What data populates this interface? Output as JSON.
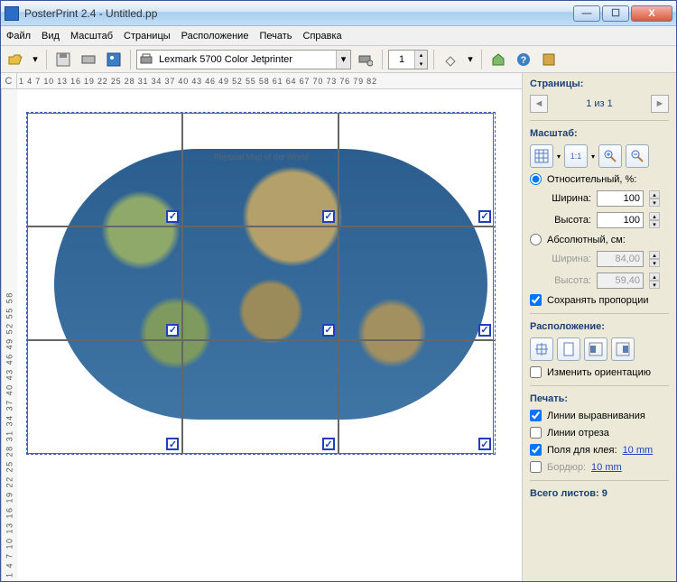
{
  "window": {
    "title": "PosterPrint 2.4 - Untitled.pp"
  },
  "menu": {
    "file": "Файл",
    "view": "Вид",
    "zoom": "Масштаб",
    "pages": "Страницы",
    "layout": "Расположение",
    "print": "Печать",
    "help": "Справка"
  },
  "toolbar": {
    "printer": "Lexmark 5700 Color Jetprinter",
    "page_spin": "1"
  },
  "ruler": {
    "h": "1  4  7  10 13 16 19 22 25 28 31 34 37 40 43 46 49 52 55 58 61 64 67 70 73 76 79 82",
    "v": "1 4 7 10 13 16 19 22 25 28 31 34 37 40 43 46 49 52 55 58",
    "corner": "C"
  },
  "canvas": {
    "map_title": "Physical Map of the World",
    "cols": 3,
    "rows": 3
  },
  "sidebar": {
    "pages": {
      "title": "Страницы:",
      "nav_text": "1 из 1"
    },
    "scale": {
      "title": "Масштаб:",
      "relative_label": "Относительный, %:",
      "absolute_label": "Абсолютный, см:",
      "width_label": "Ширина:",
      "height_label": "Высота:",
      "rel_w": "100",
      "rel_h": "100",
      "abs_w": "84,00",
      "abs_h": "59,40",
      "keep_label": "Сохранять пропорции"
    },
    "layout": {
      "title": "Расположение:",
      "rotate_label": "Изменить ориентацию"
    },
    "print": {
      "title": "Печать:",
      "align_label": "Линии выравнивания",
      "cut_label": "Линии отреза",
      "glue_label": "Поля для клея:",
      "glue_val": "10 mm",
      "border_label": "Бордюр:",
      "border_val": "10 mm"
    },
    "total": {
      "label": "Всего листов:",
      "value": "9"
    }
  }
}
